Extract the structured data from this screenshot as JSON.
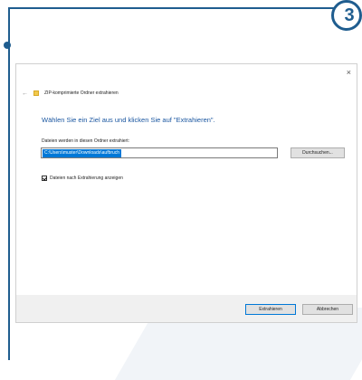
{
  "step_number": "3",
  "dialog": {
    "close_glyph": "×",
    "title": "ZIP-komprimierte Ordner extrahieren",
    "heading": "Wählen Sie ein Ziel aus und klicken Sie auf \"Extrahieren\".",
    "field_label": "Dateien werden in diesen Ordner extrahiert:",
    "path_value": "C:\\Users\\muster\\Downloads\\aufbruch",
    "browse_label": "Durchsuchen...",
    "checkbox_label": "Dateien nach Extrahierung anzeigen",
    "checkbox_checked": true,
    "extract_label": "Extrahieren",
    "cancel_label": "Abbrechen"
  },
  "colors": {
    "accent": "#1f5d8f",
    "selection": "#0078d7",
    "heading": "#1a56a0"
  }
}
